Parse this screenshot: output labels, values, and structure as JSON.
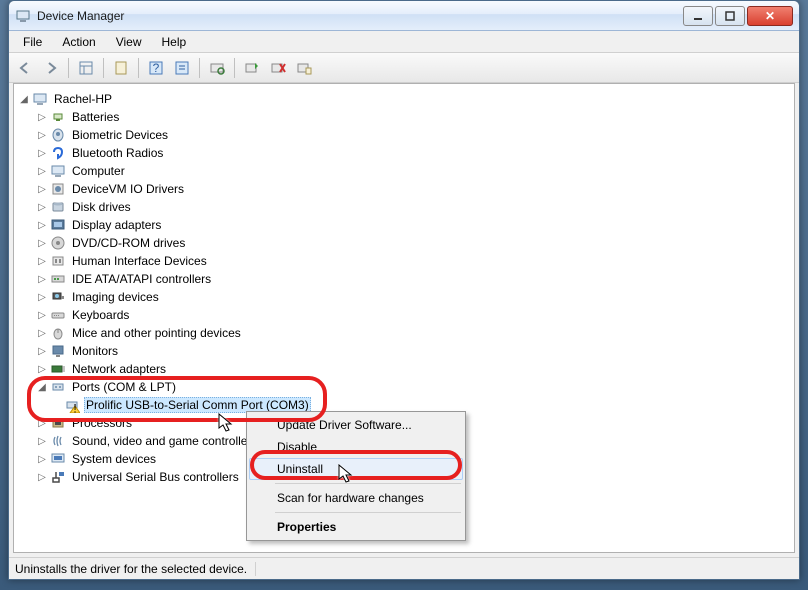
{
  "window": {
    "title": "Device Manager"
  },
  "menus": {
    "file": "File",
    "action": "Action",
    "view": "View",
    "help": "Help"
  },
  "toolbar_icons": {
    "back": "back",
    "forward": "forward",
    "up": "up",
    "show_hidden": "show-hidden",
    "props_tree": "props",
    "help": "help",
    "action": "action",
    "scan": "scan",
    "update": "update",
    "uninstall": "uninstall",
    "prop2": "prop2"
  },
  "root": "Rachel-HP",
  "categories": [
    "Batteries",
    "Biometric Devices",
    "Bluetooth Radios",
    "Computer",
    "DeviceVM IO Drivers",
    "Disk drives",
    "Display adapters",
    "DVD/CD-ROM drives",
    "Human Interface Devices",
    "IDE ATA/ATAPI controllers",
    "Imaging devices",
    "Keyboards",
    "Mice and other pointing devices",
    "Monitors",
    "Network adapters"
  ],
  "ports_label": "Ports (COM & LPT)",
  "ports_child": "Prolific USB-to-Serial Comm Port (COM3)",
  "categories_after": [
    "Processors",
    "Sound, video and game controllers",
    "System devices",
    "Universal Serial Bus controllers"
  ],
  "context_menu": {
    "update": "Update Driver Software...",
    "disable": "Disable",
    "uninstall": "Uninstall",
    "scan": "Scan for hardware changes",
    "properties": "Properties"
  },
  "status": "Uninstalls the driver for the selected device."
}
